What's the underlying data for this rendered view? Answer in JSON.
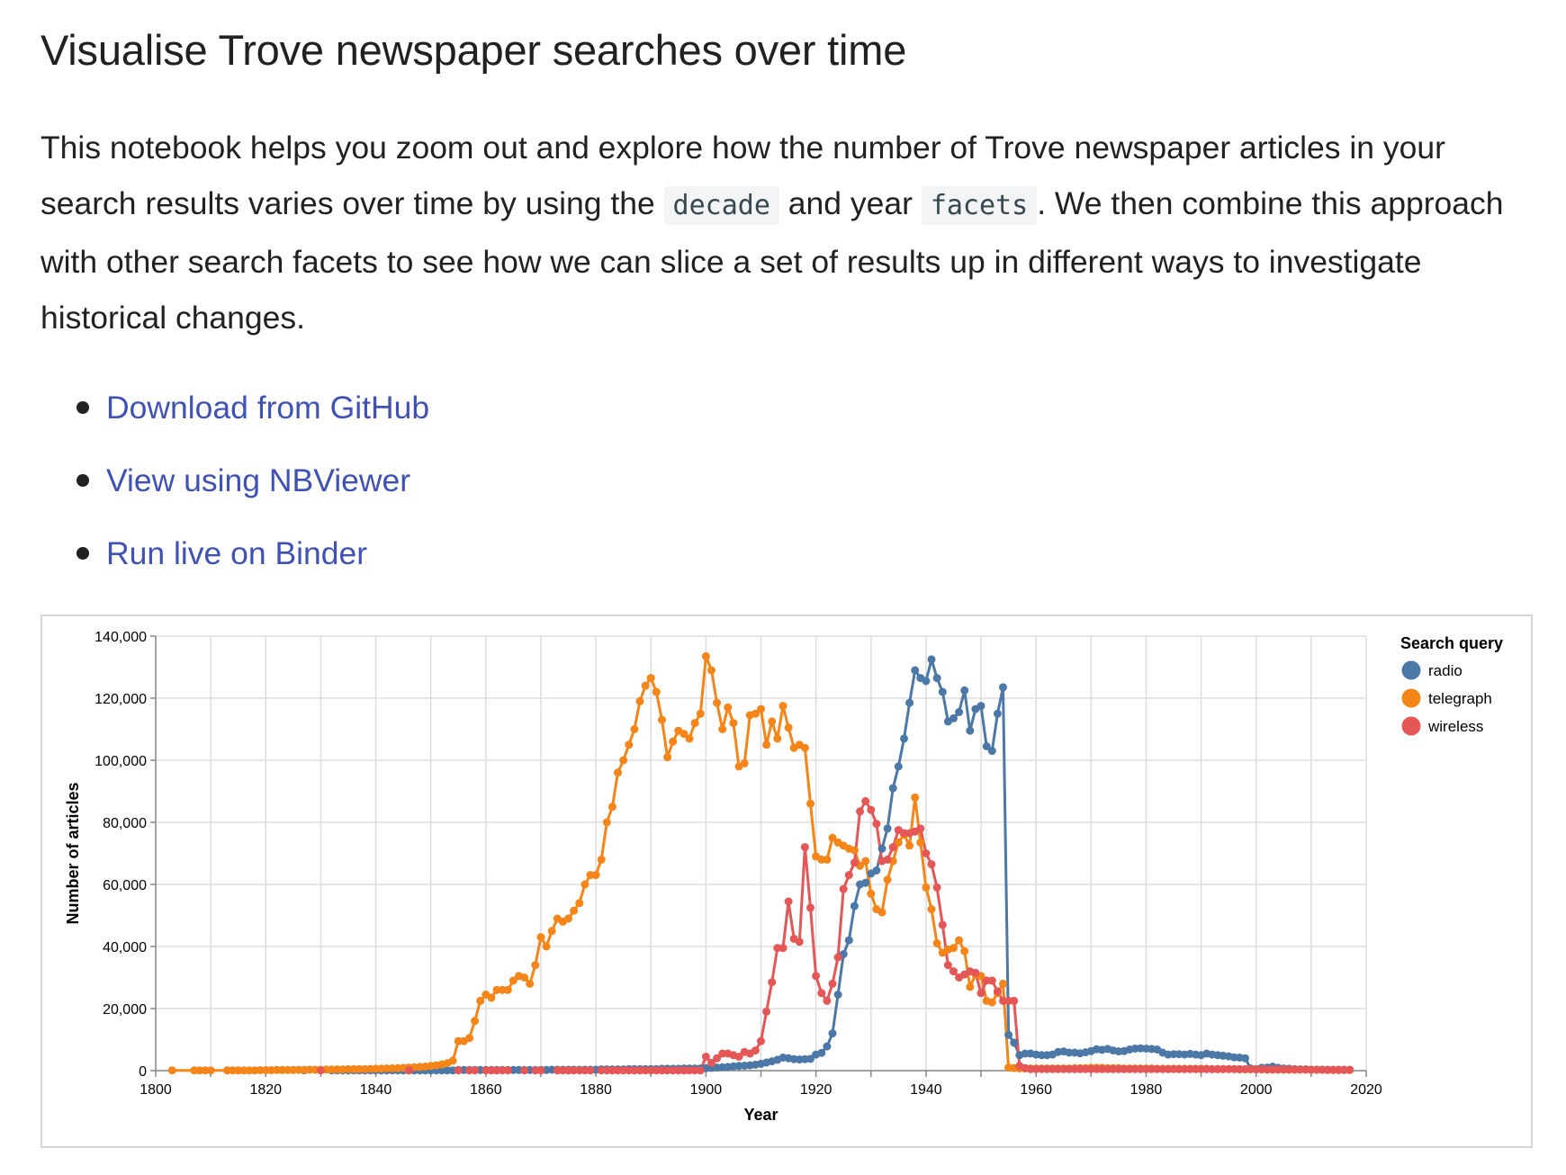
{
  "page": {
    "title": "Visualise Trove newspaper searches over time",
    "intro": {
      "part1": "This notebook helps you zoom out and explore how the number of Trove newspaper articles in your search results varies over time by using the ",
      "code1": "decade",
      "part2": " and year ",
      "code2": "facets",
      "part3": ". We then combine this approach with other search facets to see how we can slice a set of results up in different ways to investigate historical changes."
    },
    "links": [
      {
        "label": "Download from GitHub"
      },
      {
        "label": "View using NBViewer"
      },
      {
        "label": "Run live on Binder"
      }
    ],
    "link_color": "#3f51b5"
  },
  "chart_data": {
    "type": "line",
    "title": "",
    "xlabel": "Year",
    "ylabel": "Number of articles",
    "xlim": [
      1800,
      2020
    ],
    "ylim": [
      0,
      140000
    ],
    "x_ticks": [
      "1800",
      "1820",
      "1840",
      "1860",
      "1880",
      "1900",
      "1920",
      "1940",
      "1960",
      "1980",
      "2000",
      "2020"
    ],
    "x_tick_values": [
      1800,
      1820,
      1840,
      1860,
      1880,
      1900,
      1920,
      1940,
      1960,
      1980,
      2000,
      2020
    ],
    "y_ticks": [
      "0",
      "20,000",
      "40,000",
      "60,000",
      "80,000",
      "100,000",
      "120,000",
      "140,000"
    ],
    "y_tick_values": [
      0,
      20000,
      40000,
      60000,
      80000,
      100000,
      120000,
      140000
    ],
    "grid": true,
    "markers": true,
    "legend": {
      "title": "Search query",
      "position": "right"
    },
    "series": [
      {
        "name": "radio",
        "color": "#4c78a8",
        "x": [
          1827,
          1832,
          1833,
          1834,
          1835,
          1836,
          1837,
          1838,
          1839,
          1840,
          1841,
          1842,
          1843,
          1844,
          1845,
          1846,
          1847,
          1848,
          1849,
          1850,
          1851,
          1852,
          1853,
          1854,
          1855,
          1856,
          1857,
          1858,
          1859,
          1860,
          1861,
          1862,
          1863,
          1864,
          1865,
          1866,
          1867,
          1868,
          1869,
          1870,
          1871,
          1872,
          1873,
          1874,
          1875,
          1876,
          1877,
          1878,
          1879,
          1880,
          1881,
          1882,
          1883,
          1884,
          1885,
          1886,
          1887,
          1888,
          1889,
          1890,
          1891,
          1892,
          1893,
          1894,
          1895,
          1896,
          1897,
          1898,
          1899,
          1900,
          1901,
          1902,
          1903,
          1904,
          1905,
          1906,
          1907,
          1908,
          1909,
          1910,
          1911,
          1912,
          1913,
          1914,
          1915,
          1916,
          1917,
          1918,
          1919,
          1920,
          1921,
          1922,
          1923,
          1924,
          1925,
          1926,
          1927,
          1928,
          1929,
          1930,
          1931,
          1932,
          1933,
          1934,
          1935,
          1936,
          1937,
          1938,
          1939,
          1940,
          1941,
          1942,
          1943,
          1944,
          1945,
          1946,
          1947,
          1948,
          1949,
          1950,
          1951,
          1952,
          1953,
          1954,
          1955,
          1956,
          1957,
          1958,
          1959,
          1960,
          1961,
          1962,
          1963,
          1964,
          1965,
          1966,
          1967,
          1968,
          1969,
          1970,
          1971,
          1972,
          1973,
          1974,
          1975,
          1976,
          1977,
          1978,
          1979,
          1980,
          1981,
          1982,
          1983,
          1984,
          1985,
          1986,
          1987,
          1988,
          1989,
          1990,
          1991,
          1992,
          1993,
          1994,
          1995,
          1996,
          1997,
          1998,
          1999,
          2000,
          2001,
          2002,
          2003,
          2004,
          2005,
          2006,
          2007,
          2008,
          2009,
          2010,
          2011,
          2012,
          2013,
          2014,
          2015,
          2016,
          2017
        ],
        "y": [
          100,
          100,
          100,
          100,
          100,
          100,
          100,
          100,
          100,
          100,
          100,
          100,
          100,
          100,
          100,
          100,
          100,
          100,
          100,
          100,
          100,
          100,
          100,
          100,
          200,
          200,
          200,
          200,
          200,
          200,
          200,
          200,
          200,
          200,
          200,
          200,
          200,
          200,
          200,
          200,
          200,
          300,
          300,
          300,
          300,
          300,
          300,
          300,
          300,
          300,
          400,
          400,
          400,
          400,
          400,
          500,
          500,
          500,
          500,
          500,
          500,
          600,
          600,
          600,
          600,
          700,
          700,
          700,
          700,
          800,
          900,
          1000,
          1100,
          1200,
          1400,
          1500,
          1600,
          1700,
          1900,
          2200,
          2600,
          3000,
          3500,
          4200,
          4000,
          3700,
          3600,
          3700,
          3800,
          5200,
          5700,
          7800,
          12000,
          24500,
          37500,
          42000,
          53000,
          60000,
          60500,
          63500,
          64500,
          71500,
          78000,
          91000,
          98000,
          107000,
          118500,
          129000,
          126500,
          125500,
          132500,
          126500,
          122000,
          112500,
          113500,
          115500,
          122500,
          109500,
          116500,
          117500,
          104500,
          103000,
          115000,
          123500,
          11500,
          9000,
          5000,
          5500,
          5500,
          5200,
          5000,
          5000,
          5200,
          6000,
          6200,
          5800,
          5800,
          5600,
          5900,
          6300,
          6900,
          6700,
          7000,
          6500,
          6200,
          6300,
          6800,
          7100,
          7200,
          7100,
          7000,
          6800,
          5800,
          5200,
          5300,
          5300,
          5200,
          5400,
          5200,
          5000,
          5500,
          5200,
          5000,
          4800,
          4600,
          4300,
          4200,
          4000,
          700,
          500,
          900,
          1000,
          1300,
          900,
          700,
          600,
          500,
          400,
          400,
          300,
          300,
          300,
          200,
          200,
          200,
          200,
          200,
          100,
          100,
          100,
          100
        ]
      },
      {
        "name": "telegraph",
        "color": "#f58518",
        "x": [
          1803,
          1807,
          1808,
          1809,
          1810,
          1813,
          1814,
          1815,
          1816,
          1817,
          1818,
          1819,
          1820,
          1821,
          1822,
          1823,
          1824,
          1825,
          1826,
          1827,
          1828,
          1829,
          1830,
          1831,
          1832,
          1833,
          1834,
          1835,
          1836,
          1837,
          1838,
          1839,
          1840,
          1841,
          1842,
          1843,
          1844,
          1845,
          1846,
          1847,
          1848,
          1849,
          1850,
          1851,
          1852,
          1853,
          1854,
          1855,
          1856,
          1857,
          1858,
          1859,
          1860,
          1861,
          1862,
          1863,
          1864,
          1865,
          1866,
          1867,
          1868,
          1869,
          1870,
          1871,
          1872,
          1873,
          1874,
          1875,
          1876,
          1877,
          1878,
          1879,
          1880,
          1881,
          1882,
          1883,
          1884,
          1885,
          1886,
          1887,
          1888,
          1889,
          1890,
          1891,
          1892,
          1893,
          1894,
          1895,
          1896,
          1897,
          1898,
          1899,
          1900,
          1901,
          1902,
          1903,
          1904,
          1905,
          1906,
          1907,
          1908,
          1909,
          1910,
          1911,
          1912,
          1913,
          1914,
          1915,
          1916,
          1917,
          1918,
          1919,
          1920,
          1921,
          1922,
          1923,
          1924,
          1925,
          1926,
          1927,
          1928,
          1929,
          1930,
          1931,
          1932,
          1933,
          1934,
          1935,
          1936,
          1937,
          1938,
          1939,
          1940,
          1941,
          1942,
          1943,
          1944,
          1945,
          1946,
          1947,
          1948,
          1949,
          1950,
          1951,
          1952,
          1953,
          1954,
          1955,
          1956,
          1957,
          1958,
          1959,
          1960,
          1961,
          1962,
          1963,
          1964,
          1965,
          1966,
          1967,
          1968,
          1969,
          1970,
          1971,
          1972,
          1973,
          1974,
          1975,
          1976,
          1977,
          1978,
          1979,
          1980,
          1981,
          1982,
          1983,
          1984,
          1985,
          1986,
          1987,
          1988,
          1989,
          1990,
          1991,
          1992,
          1993,
          1994,
          1995,
          1996,
          1997,
          1998,
          1999,
          2000,
          2001,
          2002,
          2003,
          2004,
          2005,
          2006,
          2007,
          2008,
          2009,
          2010,
          2011,
          2012,
          2013,
          2014,
          2015,
          2016,
          2017
        ],
        "y": [
          100,
          100,
          100,
          100,
          100,
          100,
          100,
          100,
          100,
          100,
          100,
          150,
          150,
          150,
          200,
          200,
          200,
          200,
          250,
          250,
          300,
          300,
          300,
          350,
          350,
          400,
          400,
          450,
          450,
          500,
          500,
          550,
          600,
          650,
          700,
          750,
          800,
          900,
          1000,
          1100,
          1200,
          1300,
          1500,
          1700,
          2000,
          2400,
          3200,
          9500,
          9500,
          10500,
          16000,
          22500,
          24500,
          23500,
          26000,
          26000,
          26000,
          29000,
          30500,
          30000,
          28000,
          34000,
          43000,
          40000,
          45000,
          49000,
          48000,
          49000,
          51500,
          54000,
          60000,
          63000,
          63000,
          68000,
          80000,
          85000,
          96000,
          100000,
          105000,
          110000,
          119000,
          124000,
          126500,
          122000,
          113000,
          101000,
          106000,
          109500,
          108500,
          107000,
          112000,
          115000,
          133500,
          129000,
          118500,
          110000,
          117000,
          112000,
          98000,
          99000,
          114500,
          115000,
          116500,
          105000,
          112500,
          107000,
          117500,
          110500,
          104000,
          105000,
          104000,
          86000,
          69000,
          68000,
          68000,
          75000,
          73500,
          72500,
          71500,
          71000,
          66000,
          67500,
          57000,
          52000,
          51000,
          61500,
          67500,
          73500,
          76000,
          72500,
          88000,
          73500,
          59000,
          52000,
          41000,
          38000,
          39000,
          39500,
          42000,
          38500,
          27000,
          31000,
          30500,
          22500,
          22000,
          25000,
          28000,
          1000,
          800,
          700,
          700,
          700,
          700,
          700,
          700,
          700,
          700,
          700,
          700,
          800,
          800,
          800,
          900,
          900,
          900,
          800,
          800,
          800,
          700,
          700,
          700,
          700,
          700,
          700,
          600,
          600,
          600,
          600,
          600,
          600,
          600,
          600,
          600,
          600,
          500,
          500,
          500,
          500,
          500,
          400,
          400,
          400,
          400,
          400,
          300,
          300,
          300,
          300,
          300,
          300,
          300,
          300,
          300,
          300,
          300,
          200,
          200,
          200,
          200,
          200,
          200
        ]
      },
      {
        "name": "wireless",
        "color": "#e45756",
        "x": [
          1830,
          1846,
          1855,
          1857,
          1858,
          1860,
          1861,
          1862,
          1863,
          1864,
          1867,
          1869,
          1870,
          1873,
          1874,
          1875,
          1876,
          1877,
          1878,
          1879,
          1881,
          1882,
          1883,
          1884,
          1885,
          1886,
          1887,
          1888,
          1889,
          1890,
          1891,
          1892,
          1893,
          1894,
          1895,
          1896,
          1897,
          1898,
          1899,
          1900,
          1901,
          1902,
          1903,
          1904,
          1905,
          1906,
          1907,
          1908,
          1909,
          1910,
          1911,
          1912,
          1913,
          1914,
          1915,
          1916,
          1917,
          1918,
          1919,
          1920,
          1921,
          1922,
          1923,
          1924,
          1925,
          1926,
          1927,
          1928,
          1929,
          1930,
          1931,
          1932,
          1933,
          1934,
          1935,
          1936,
          1937,
          1938,
          1939,
          1940,
          1941,
          1942,
          1943,
          1944,
          1945,
          1946,
          1947,
          1948,
          1949,
          1950,
          1951,
          1952,
          1953,
          1954,
          1955,
          1956,
          1957,
          1958,
          1959,
          1960,
          1961,
          1962,
          1963,
          1964,
          1965,
          1966,
          1967,
          1968,
          1969,
          1970,
          1971,
          1972,
          1973,
          1974,
          1975,
          1976,
          1977,
          1978,
          1979,
          1980,
          1981,
          1982,
          1983,
          1984,
          1985,
          1986,
          1987,
          1988,
          1989,
          1990,
          1991,
          1992,
          1993,
          1994,
          1995,
          1996,
          1997,
          1998,
          1999,
          2000,
          2001,
          2002,
          2003,
          2004,
          2005,
          2006,
          2007,
          2008,
          2009,
          2010,
          2011,
          2012,
          2013,
          2014,
          2015,
          2016,
          2017
        ],
        "y": [
          100,
          100,
          100,
          100,
          100,
          100,
          100,
          100,
          100,
          100,
          100,
          100,
          100,
          100,
          100,
          100,
          100,
          100,
          100,
          100,
          100,
          100,
          100,
          100,
          100,
          100,
          100,
          100,
          100,
          100,
          100,
          100,
          100,
          100,
          100,
          100,
          100,
          100,
          100,
          4500,
          2500,
          4000,
          5500,
          5500,
          5000,
          4500,
          6000,
          5500,
          6500,
          9500,
          19000,
          28500,
          39500,
          39500,
          54500,
          42500,
          41500,
          72000,
          52500,
          30500,
          25000,
          22500,
          28000,
          36500,
          58500,
          63000,
          67000,
          83500,
          86800,
          84000,
          79500,
          67500,
          68000,
          72000,
          77500,
          76500,
          76500,
          77000,
          78000,
          70000,
          66500,
          59000,
          47000,
          34000,
          32000,
          30000,
          31000,
          32000,
          31500,
          25000,
          29000,
          29000,
          25500,
          22500,
          22500,
          22500,
          1500,
          800,
          500,
          500,
          500,
          500,
          500,
          500,
          500,
          500,
          500,
          500,
          500,
          500,
          500,
          500,
          500,
          500,
          500,
          500,
          500,
          500,
          500,
          500,
          500,
          500,
          500,
          500,
          500,
          500,
          500,
          500,
          500,
          500,
          500,
          500,
          500,
          500,
          500,
          500,
          500,
          500,
          500,
          400,
          400,
          400,
          400,
          400,
          400,
          400,
          400,
          400,
          400,
          300,
          300,
          300,
          300,
          300,
          300,
          300,
          300,
          300,
          300,
          300
        ]
      }
    ]
  }
}
